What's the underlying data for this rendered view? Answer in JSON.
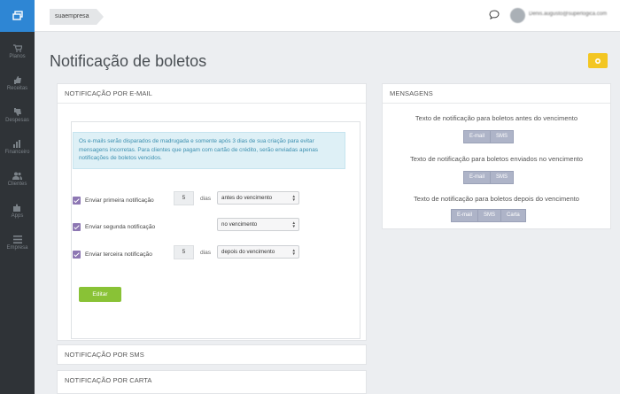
{
  "topbar": {
    "breadcrumb": "suaempresa",
    "user_email": "Denis.augusto@superlogica.com"
  },
  "sidebar": {
    "items": [
      {
        "label": "Planos",
        "icon": "cart-icon"
      },
      {
        "label": "Receitas",
        "icon": "thumbs-up-icon"
      },
      {
        "label": "Despesas",
        "icon": "thumbs-down-icon"
      },
      {
        "label": "Financeiro",
        "icon": "bar-chart-icon"
      },
      {
        "label": "Clientes",
        "icon": "users-icon"
      },
      {
        "label": "Apps",
        "icon": "puzzle-icon"
      },
      {
        "label": "Empresa",
        "icon": "menu-icon"
      }
    ]
  },
  "page": {
    "title": "Notificação de boletos"
  },
  "email_panel": {
    "header": "NOTIFICAÇÃO POR E-MAIL",
    "info": "Os e-mails serão disparados de madrugada e somente após 3 dias de sua criação para evitar mensagens incorretas. Para clientes que pagam com cartão de crédito, serão enviadas apenas notificações de boletos vencidos.",
    "rows": [
      {
        "label": "Enviar primeira notificação",
        "days": "5",
        "days_label": "dias",
        "select": "antes do vencimento"
      },
      {
        "label": "Enviar segunda notificação",
        "select": "no vencimento"
      },
      {
        "label": "Enviar terceira notificação",
        "days": "5",
        "days_label": "dias",
        "select": "depois do vencimento"
      }
    ],
    "edit_label": "Editar"
  },
  "sms_panel": {
    "header": "NOTIFICAÇÃO POR SMS"
  },
  "card_panel": {
    "header": "NOTIFICAÇÃO POR CARTA"
  },
  "messages_panel": {
    "header": "MENSAGENS",
    "groups": [
      {
        "title": "Texto de notificação para boletos antes do vencimento",
        "buttons": [
          "E-mail",
          "SMS"
        ]
      },
      {
        "title": "Texto de notificação para boletos enviados no vencimento",
        "buttons": [
          "E-mail",
          "SMS"
        ]
      },
      {
        "title": "Texto de notificação para boletos depois do vencimento",
        "buttons": [
          "E-mail",
          "SMS",
          "Carta"
        ]
      }
    ]
  },
  "colors": {
    "accent": "#2e86d4",
    "sidebar": "#2f3337",
    "edit": "#89c236",
    "warning": "#f3c622",
    "checkbox": "#8d77b3"
  }
}
